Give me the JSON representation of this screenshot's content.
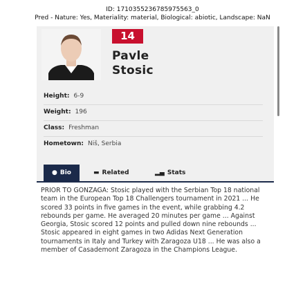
{
  "caption": {
    "line1": "ID: 1710355236785975563_0",
    "line2": "Pred - Nature: Yes, Materiality: material, Biological: abiotic, Landscape: NaN"
  },
  "player": {
    "number": "14",
    "first_name": "Pavle",
    "last_name": "Stosic"
  },
  "info": [
    {
      "label": "Height:",
      "value": "6-9"
    },
    {
      "label": "Weight:",
      "value": "196"
    },
    {
      "label": "Class:",
      "value": "Freshman"
    },
    {
      "label": "Hometown:",
      "value": "Niš, Serbia"
    }
  ],
  "tabs": [
    {
      "label": "Bio",
      "icon": "chat-bubble-icon",
      "active": true
    },
    {
      "label": "Related",
      "icon": "newspaper-icon",
      "active": false
    },
    {
      "label": "Stats",
      "icon": "bar-chart-icon",
      "active": false
    }
  ],
  "bio": "PRIOR TO GONZAGA: Stosic played with the Serbian Top 18 national team in the European Top 18 Challengers tournament in 2021 ... He scored 33 points in five games in the event, while grabbing 4.2 rebounds per game. He averaged 20 minutes per game ... Against Georgia, Stosic scored 12 points and pulled down nine rebounds ... Stosic appeared in eight games in two Adidas Next Generation tournaments in Italy and Turkey with Zaragoza U18 ... He was also a member of Casademont Zaragoza in the Champions League.",
  "colors": {
    "accent": "#c8102e",
    "navy": "#1b2a4a"
  }
}
